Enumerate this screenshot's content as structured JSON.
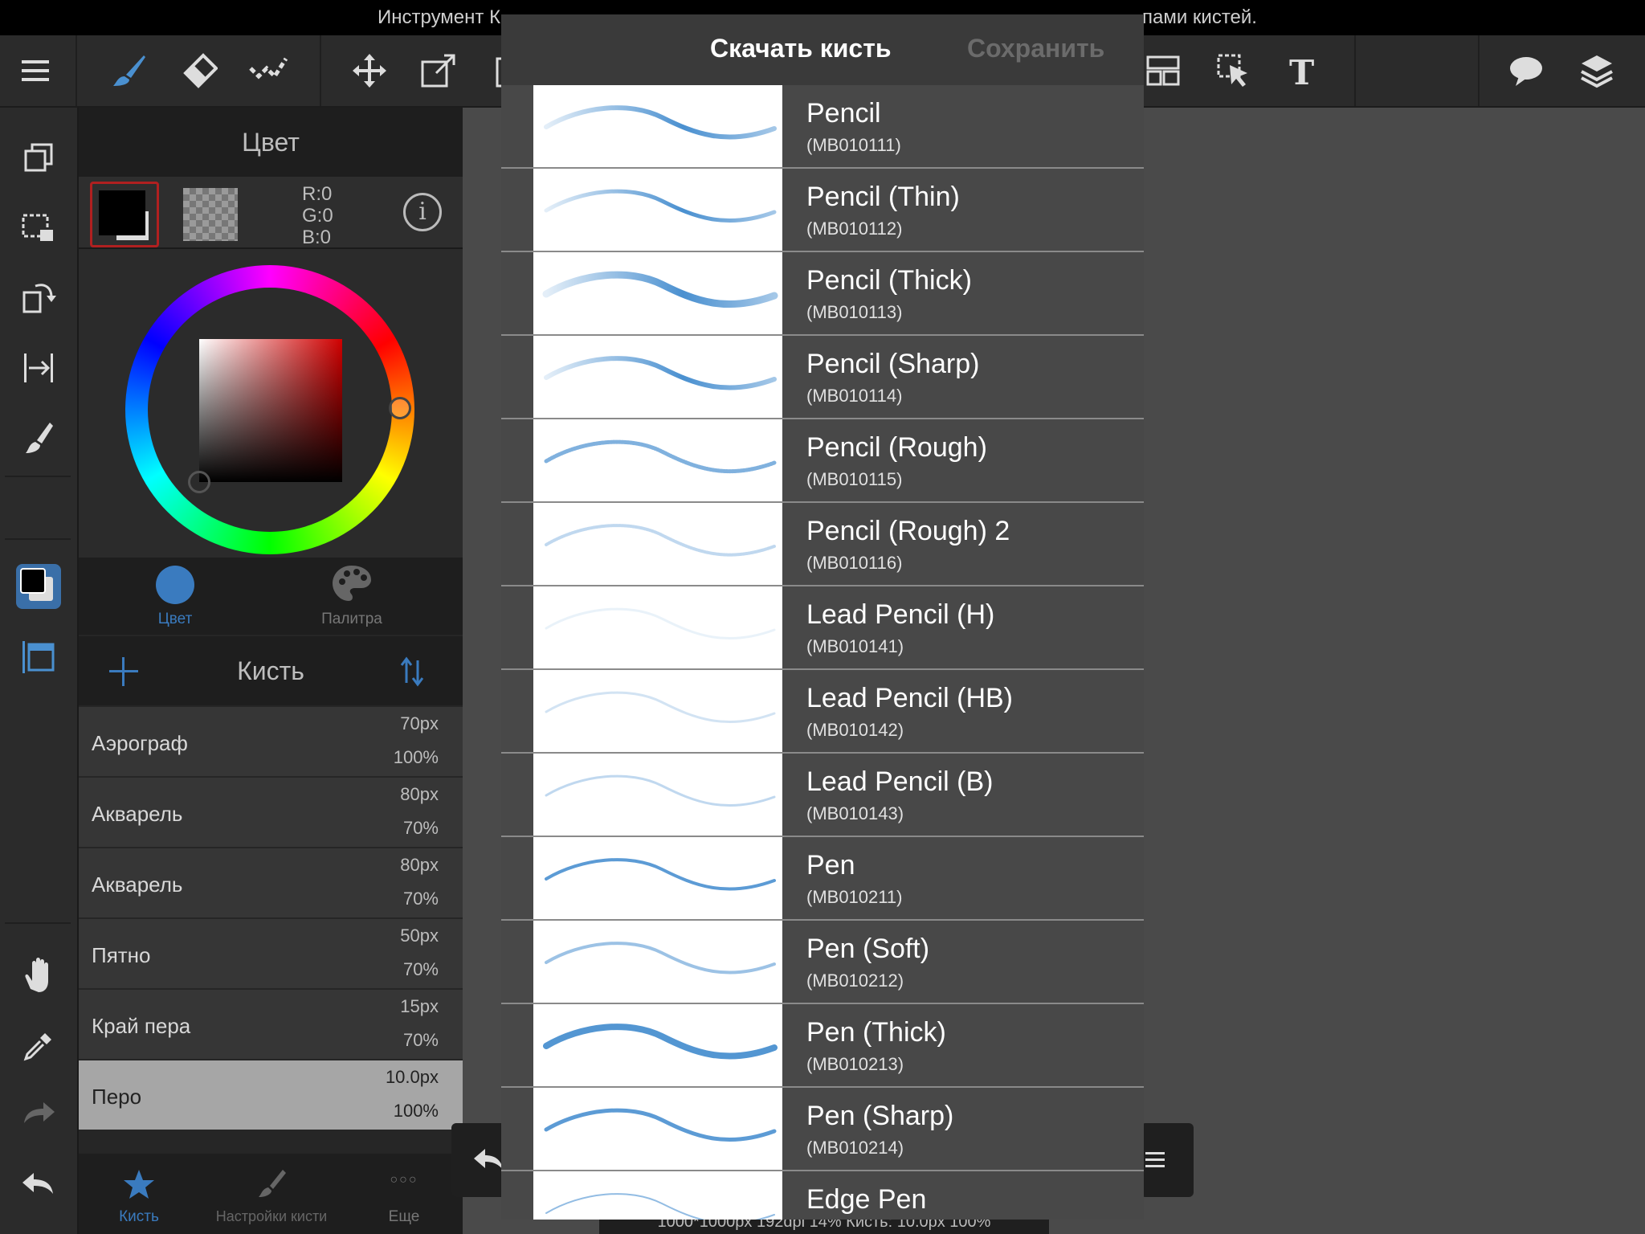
{
  "topbar": {
    "message_left": "Инструмент К",
    "message_right": "пами кистей."
  },
  "toolbar": {
    "icons": [
      "menu-icon",
      "brush-icon",
      "eraser-icon",
      "selection-brush-icon",
      "move-icon",
      "transform-icon",
      "crop-icon",
      "panel-layout-icon",
      "select-layer-icon",
      "text-icon",
      "speech-bubble-icon",
      "layers-icon"
    ]
  },
  "color_panel": {
    "title": "Цвет",
    "r": "R:0",
    "g": "G:0",
    "b": "B:0",
    "tab_color": "Цвет",
    "tab_palette": "Палитра"
  },
  "brush_panel": {
    "title": "Кисть",
    "items": [
      {
        "name": "Аэрограф",
        "size": "70px",
        "opacity": "100%"
      },
      {
        "name": "Акварель",
        "size": "80px",
        "opacity": "70%"
      },
      {
        "name": "Акварель",
        "size": "80px",
        "opacity": "70%"
      },
      {
        "name": "Пятно",
        "size": "50px",
        "opacity": "70%"
      },
      {
        "name": "Край пера",
        "size": "15px",
        "opacity": "70%"
      },
      {
        "name": "Перо",
        "size": "10.0px",
        "opacity": "100%"
      }
    ],
    "tab_brush": "Кисть",
    "tab_settings": "Настройки кисти",
    "tab_more": "Еще",
    "more_glyph": "○○○"
  },
  "modal": {
    "title": "Скачать кисть",
    "save": "Сохранить",
    "brushes": [
      {
        "title": "Pencil",
        "code": "(MB010111)"
      },
      {
        "title": "Pencil (Thin)",
        "code": "(MB010112)"
      },
      {
        "title": "Pencil (Thick)",
        "code": "(MB010113)"
      },
      {
        "title": "Pencil (Sharp)",
        "code": "(MB010114)"
      },
      {
        "title": "Pencil (Rough)",
        "code": "(MB010115)"
      },
      {
        "title": "Pencil (Rough) 2",
        "code": "(MB010116)"
      },
      {
        "title": "Lead Pencil (H)",
        "code": "(MB010141)"
      },
      {
        "title": "Lead Pencil (HB)",
        "code": "(MB010142)"
      },
      {
        "title": "Lead Pencil (B)",
        "code": "(MB010143)"
      },
      {
        "title": "Pen",
        "code": "(MB010211)"
      },
      {
        "title": "Pen (Soft)",
        "code": "(MB010212)"
      },
      {
        "title": "Pen (Thick)",
        "code": "(MB010213)"
      },
      {
        "title": "Pen (Sharp)",
        "code": "(MB010214)"
      },
      {
        "title": "Edge Pen",
        "code": ""
      }
    ]
  },
  "statusbar": {
    "text": "1000*1000px 192dpi 14% Кисть: 10.0px 100%"
  },
  "colors": {
    "accent": "#3a7bbf",
    "stroke": "#4a90d0",
    "primary_swatch": "#000000"
  }
}
